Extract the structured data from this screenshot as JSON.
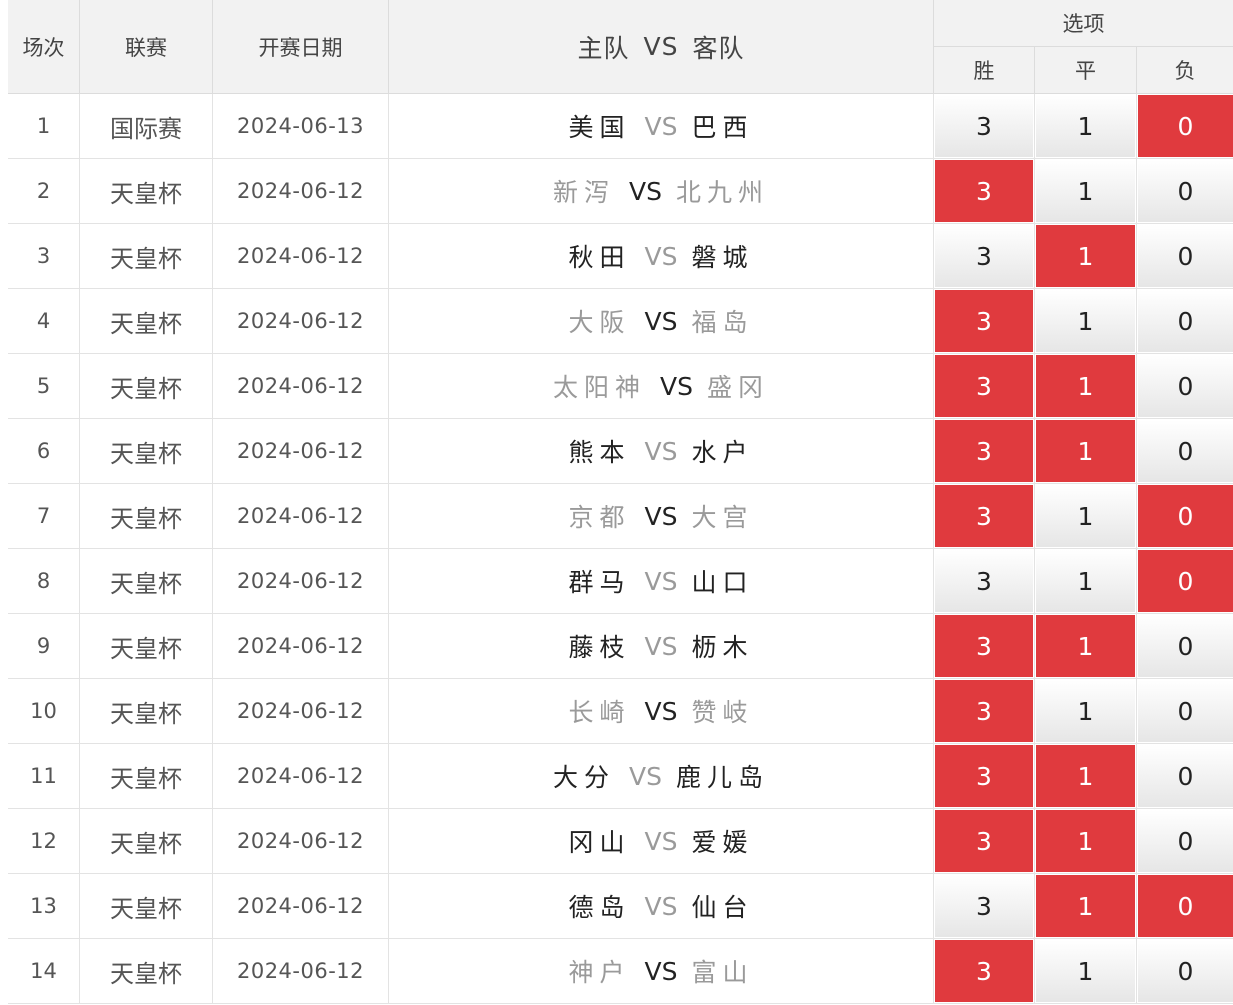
{
  "header": {
    "col_index": "场次",
    "col_league": "联赛",
    "col_date": "开赛日期",
    "col_match_home": "主队",
    "col_match_vs": "VS",
    "col_match_away": "客队",
    "options_title": "选项",
    "opt_win": "胜",
    "opt_draw": "平",
    "opt_loss": "负"
  },
  "colors": {
    "selected": "#e03a3e",
    "header_bg": "#f2f2f2"
  },
  "rows": [
    {
      "idx": "1",
      "league": "国际赛",
      "date": "2024-06-13",
      "home": "美国",
      "vs": "VS",
      "away": "巴西",
      "muted": false,
      "win": "3",
      "draw": "1",
      "loss": "0",
      "sel": [
        false,
        false,
        true
      ]
    },
    {
      "idx": "2",
      "league": "天皇杯",
      "date": "2024-06-12",
      "home": "新泻",
      "vs": "VS",
      "away": "北九州",
      "muted": true,
      "win": "3",
      "draw": "1",
      "loss": "0",
      "sel": [
        true,
        false,
        false
      ]
    },
    {
      "idx": "3",
      "league": "天皇杯",
      "date": "2024-06-12",
      "home": "秋田",
      "vs": "VS",
      "away": "磐城",
      "muted": false,
      "win": "3",
      "draw": "1",
      "loss": "0",
      "sel": [
        false,
        true,
        false
      ]
    },
    {
      "idx": "4",
      "league": "天皇杯",
      "date": "2024-06-12",
      "home": "大阪",
      "vs": "VS",
      "away": "福岛",
      "muted": true,
      "win": "3",
      "draw": "1",
      "loss": "0",
      "sel": [
        true,
        false,
        false
      ]
    },
    {
      "idx": "5",
      "league": "天皇杯",
      "date": "2024-06-12",
      "home": "太阳神",
      "vs": "VS",
      "away": "盛冈",
      "muted": true,
      "win": "3",
      "draw": "1",
      "loss": "0",
      "sel": [
        true,
        true,
        false
      ]
    },
    {
      "idx": "6",
      "league": "天皇杯",
      "date": "2024-06-12",
      "home": "熊本",
      "vs": "VS",
      "away": "水户",
      "muted": false,
      "win": "3",
      "draw": "1",
      "loss": "0",
      "sel": [
        true,
        true,
        false
      ]
    },
    {
      "idx": "7",
      "league": "天皇杯",
      "date": "2024-06-12",
      "home": "京都",
      "vs": "VS",
      "away": "大宫",
      "muted": true,
      "win": "3",
      "draw": "1",
      "loss": "0",
      "sel": [
        true,
        false,
        true
      ]
    },
    {
      "idx": "8",
      "league": "天皇杯",
      "date": "2024-06-12",
      "home": "群马",
      "vs": "VS",
      "away": "山口",
      "muted": false,
      "win": "3",
      "draw": "1",
      "loss": "0",
      "sel": [
        false,
        false,
        true
      ]
    },
    {
      "idx": "9",
      "league": "天皇杯",
      "date": "2024-06-12",
      "home": "藤枝",
      "vs": "VS",
      "away": "枥木",
      "muted": false,
      "win": "3",
      "draw": "1",
      "loss": "0",
      "sel": [
        true,
        true,
        false
      ]
    },
    {
      "idx": "10",
      "league": "天皇杯",
      "date": "2024-06-12",
      "home": "长崎",
      "vs": "VS",
      "away": "赞岐",
      "muted": true,
      "win": "3",
      "draw": "1",
      "loss": "0",
      "sel": [
        true,
        false,
        false
      ]
    },
    {
      "idx": "11",
      "league": "天皇杯",
      "date": "2024-06-12",
      "home": "大分",
      "vs": "VS",
      "away": "鹿儿岛",
      "muted": false,
      "win": "3",
      "draw": "1",
      "loss": "0",
      "sel": [
        true,
        true,
        false
      ]
    },
    {
      "idx": "12",
      "league": "天皇杯",
      "date": "2024-06-12",
      "home": "冈山",
      "vs": "VS",
      "away": "爱媛",
      "muted": false,
      "win": "3",
      "draw": "1",
      "loss": "0",
      "sel": [
        true,
        true,
        false
      ]
    },
    {
      "idx": "13",
      "league": "天皇杯",
      "date": "2024-06-12",
      "home": "德岛",
      "vs": "VS",
      "away": "仙台",
      "muted": false,
      "win": "3",
      "draw": "1",
      "loss": "0",
      "sel": [
        false,
        true,
        true
      ]
    },
    {
      "idx": "14",
      "league": "天皇杯",
      "date": "2024-06-12",
      "home": "神户",
      "vs": "VS",
      "away": "富山",
      "muted": true,
      "win": "3",
      "draw": "1",
      "loss": "0",
      "sel": [
        true,
        false,
        false
      ]
    }
  ]
}
